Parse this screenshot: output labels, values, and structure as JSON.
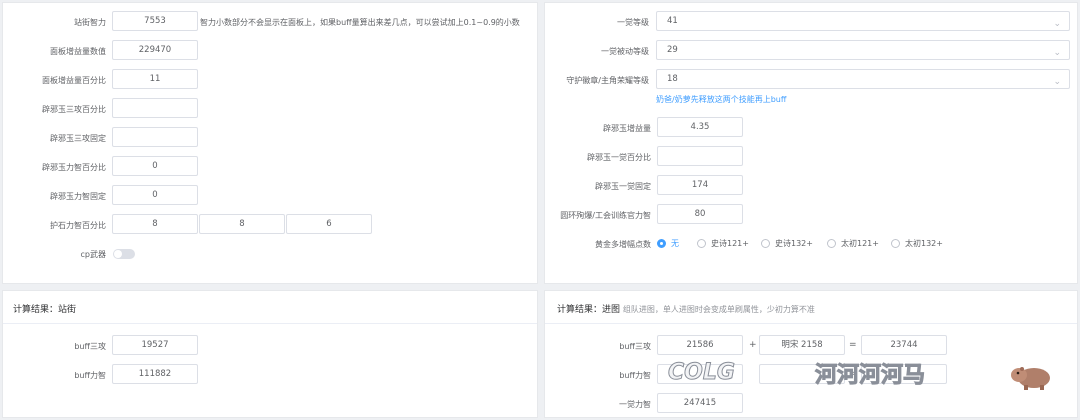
{
  "left_form": {
    "fields": [
      {
        "label": "站街智力",
        "value": "7553"
      },
      {
        "label": "面板增益量数值",
        "value": "229470"
      },
      {
        "label": "面板增益量百分比",
        "value": "11"
      },
      {
        "label": "辟邪玉三攻百分比",
        "value": ""
      },
      {
        "label": "辟邪玉三攻固定",
        "value": ""
      },
      {
        "label": "辟邪玉力智百分比",
        "value": "0"
      },
      {
        "label": "辟邪玉力智固定",
        "value": "0"
      }
    ],
    "hint": "智力小数部分不会显示在面板上，如果buff量算出来差几点，可以尝试加上0.1~0.9的小数",
    "pet_label": "护石力智百分比",
    "pet_values": [
      "8",
      "8",
      "6"
    ],
    "cp_label": "cp武器"
  },
  "right_form": {
    "selects": [
      {
        "label": "一觉等级",
        "value": "41"
      },
      {
        "label": "一觉被动等级",
        "value": "29"
      },
      {
        "label": "守护徽章/主角荣耀等级",
        "value": "18"
      }
    ],
    "select_hint": "奶爸/奶萝先释放这两个技能再上buff",
    "fields": [
      {
        "label": "辟邪玉增益量",
        "value": "4.35"
      },
      {
        "label": "辟邪玉一觉百分比",
        "value": ""
      },
      {
        "label": "辟邪玉一觉固定",
        "value": "174"
      },
      {
        "label": "圆环殉爆/工会训练官力智",
        "value": "80"
      }
    ],
    "radio_label": "黄金多增幅点数",
    "radios": [
      "无",
      "史诗121+",
      "史诗132+",
      "太初121+",
      "太初132+"
    ]
  },
  "result_left": {
    "title": "计算结果：站街",
    "rows": [
      {
        "label": "buff三攻",
        "value": "19527"
      },
      {
        "label": "buff力智",
        "value": "111882"
      }
    ]
  },
  "result_right": {
    "title": "计算结果：进图",
    "subtitle": "组队进图，单人进图时会变成单刷属性，少初力算不准",
    "rows": [
      {
        "label": "buff三攻",
        "value": "21586",
        "op1": "+",
        "extra": "明宋     2158",
        "op2": "=",
        "total": "23744"
      },
      {
        "label": "buff力智",
        "value": "",
        "op1": "",
        "extra": "",
        "op2": "=",
        "total": ""
      },
      {
        "label": "一觉力智",
        "value": "247415"
      }
    ]
  },
  "watermark": {
    "brand": "COLG",
    "text": "河河河河马"
  }
}
